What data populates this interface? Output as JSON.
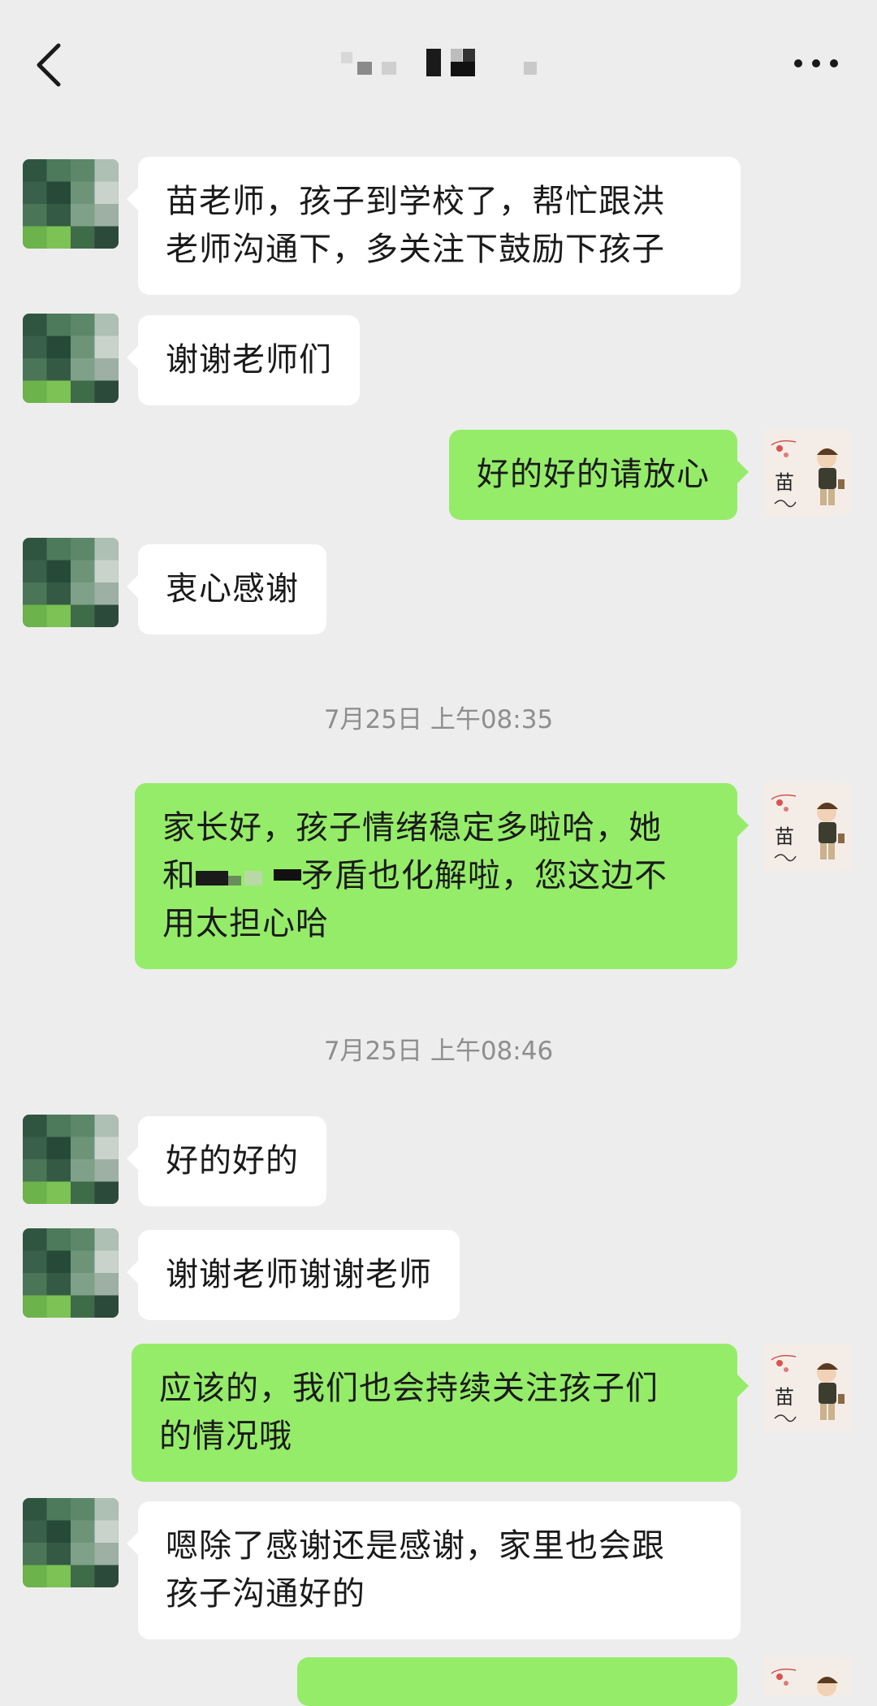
{
  "header": {
    "back_icon": "chevron-left-icon",
    "more_icon": "more-dots-icon"
  },
  "self_avatar": {
    "char": "苗",
    "icon": "cartoon-boy-avatar"
  },
  "messages": [
    {
      "from": "other",
      "text_lines": [
        "苗老师，孩子到学校了，帮忙跟洪",
        "老师沟通下，多关注下鼓励下孩子"
      ]
    },
    {
      "from": "other",
      "text": "谢谢老师们"
    },
    {
      "from": "me",
      "text": "好的好的请放心"
    },
    {
      "from": "other",
      "text": "衷心感谢"
    },
    {
      "type": "time",
      "text": "7月25日 上午08:35"
    },
    {
      "from": "me",
      "text_lines": [
        "家长好，孩子情绪稳定多啦哈，她",
        "矛盾也化解啦，您这边不",
        "用太担心哈"
      ],
      "prefix": "和"
    },
    {
      "type": "time",
      "text": "7月25日 上午08:46"
    },
    {
      "from": "other",
      "text": "好的好的"
    },
    {
      "from": "other",
      "text": "谢谢老师谢谢老师"
    },
    {
      "from": "me",
      "text_lines": [
        "应该的，我们也会持续关注孩子们",
        "的情况哦"
      ]
    },
    {
      "from": "other",
      "text_lines": [
        "嗯除了感谢还是感谢，家里也会跟",
        "孩子沟通好的"
      ]
    }
  ],
  "colors": {
    "background": "#ededed",
    "incoming_bubble": "#ffffff",
    "outgoing_bubble": "#95ec69",
    "timestamp": "#8e8e8e"
  }
}
